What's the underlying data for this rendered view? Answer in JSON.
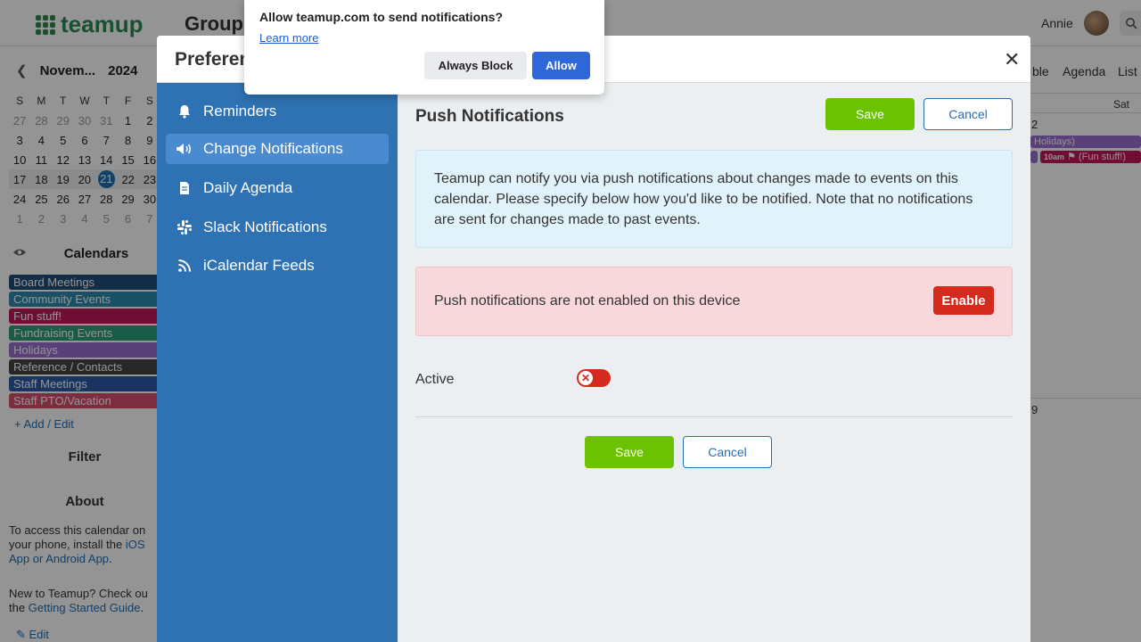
{
  "app": {
    "logo_text": "teamup",
    "group_title": "Group",
    "user_name": "Annie"
  },
  "mini_calendar": {
    "month": "Novem...",
    "year": "2024",
    "weekdays": [
      "S",
      "M",
      "T",
      "W",
      "T",
      "F",
      "S"
    ],
    "weeks": [
      [
        "27",
        "28",
        "29",
        "30",
        "31",
        "1",
        "2"
      ],
      [
        "3",
        "4",
        "5",
        "6",
        "7",
        "8",
        "9"
      ],
      [
        "10",
        "11",
        "12",
        "13",
        "14",
        "15",
        "16"
      ],
      [
        "17",
        "18",
        "19",
        "20",
        "21",
        "22",
        "23"
      ],
      [
        "24",
        "25",
        "26",
        "27",
        "28",
        "29",
        "30"
      ],
      [
        "1",
        "2",
        "3",
        "4",
        "5",
        "6",
        "7"
      ]
    ],
    "today": "21"
  },
  "calendars": {
    "title": "Calendars",
    "items": [
      {
        "label": "Board Meetings",
        "color": "#1f4e79"
      },
      {
        "label": "Community Events",
        "color": "#2e8bb0"
      },
      {
        "label": "Fun stuff!",
        "color": "#c2185b"
      },
      {
        "label": "Fundraising Events",
        "color": "#2e9e7a"
      },
      {
        "label": "Holidays",
        "color": "#9b6fd0"
      },
      {
        "label": "Reference / Contacts",
        "color": "#444444"
      },
      {
        "label": "Staff Meetings",
        "color": "#2c5aa8"
      },
      {
        "label": "Staff PTO/Vacation",
        "color": "#d6506f"
      }
    ],
    "add_edit_label": "Add / Edit"
  },
  "sidebar_sections": {
    "filter": "Filter",
    "about": "About",
    "about_text_1a": "To access this calendar on",
    "about_text_1b": "your phone, install the",
    "about_link_1a": "iOS",
    "about_link_1b": "App or Android App",
    "about_text_2a": "New to Teamup? Check ou",
    "about_text_2b": "the",
    "about_link_2": "Getting Started Guide",
    "edit_label": "Edit"
  },
  "background_view": {
    "tabs": [
      "ble",
      "Agenda",
      "List"
    ],
    "day_header": "Sat",
    "day_numbers": [
      "2",
      "9"
    ],
    "events": [
      {
        "label": "Holidays)",
        "color": "#9b6fd0"
      },
      {
        "time": "10am",
        "label": "(Fun stuff!)",
        "color": "#c2185b"
      }
    ]
  },
  "modal": {
    "title": "Preferen",
    "close_label": "✕",
    "nav": [
      {
        "label": "Reminders",
        "icon": "bell-icon"
      },
      {
        "label": "Change Notifications",
        "icon": "megaphone-icon",
        "active": true
      },
      {
        "label": "Daily Agenda",
        "icon": "document-icon"
      },
      {
        "label": "Slack Notifications",
        "icon": "slack-icon"
      },
      {
        "label": "iCalendar Feeds",
        "icon": "rss-icon"
      }
    ],
    "section_title": "Push Notifications",
    "save_label": "Save",
    "cancel_label": "Cancel",
    "info_text": "Teamup can notify you via push notifications about changes made to events on this calendar. Please specify below how you'd like to be notified. Note that no notifications are sent for changes made to past events.",
    "warning_text": "Push notifications are not enabled on this device",
    "enable_label": "Enable",
    "active_label": "Active",
    "active_on": false
  },
  "browser_prompt": {
    "title": "Allow teamup.com to send notifications?",
    "learn_more": "Learn more",
    "block_label": "Always Block",
    "allow_label": "Allow"
  }
}
